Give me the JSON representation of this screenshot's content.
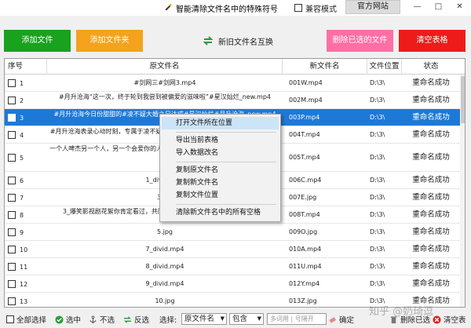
{
  "titlebar": {
    "title": "智能清除文件名中的特殊符号",
    "compat_label": "兼容模式",
    "website_label": "官方网站",
    "minimize": "—",
    "maximize": "□",
    "close": "✕"
  },
  "toolbar": {
    "add_file": "添加文件",
    "add_folder": "添加文件夹",
    "swap_names": "新旧文件名互换",
    "delete_selected": "删除已选的文件",
    "clear_table": "清空表格",
    "colors": {
      "add_file": "#18a21d",
      "add_folder": "#f5a21d",
      "delete_selected": "#ff6fa5",
      "clear_table": "#ee1b1b"
    }
  },
  "table": {
    "headers": {
      "num": "序号",
      "original": "原文件名",
      "new": "新文件名",
      "location": "文件位置",
      "status": "状态"
    },
    "rows": [
      {
        "num": "1",
        "original": "#剑网三#剑网3.mp4",
        "new": "001W.mp4",
        "location": "D:\\3\\",
        "status": "重命名成功"
      },
      {
        "num": "2",
        "original": "#月升沧海“这一次，终于轮到我尝到被偏爱的滋味啦”#星汉灿烂_new.mp4",
        "new": "002M.mp4",
        "location": "D:\\3\\",
        "status": "重命名成功"
      },
      {
        "num": "3",
        "original": "#月升沧海今日份甜甜的#凌不疑大婚之日达成#星汉灿烂#月升沧海_new.mp4",
        "new": "003P.mp4",
        "location": "D:\\3\\",
        "status": "重命名成功"
      },
      {
        "num": "4",
        "original": "#月升沧海表录心动时刻，专属于凌不疑的程少商#星汉灿烂#心动七夕_new.mp4",
        "new": "004T.mp4",
        "location": "D:\\3\\",
        "status": "重命名成功"
      },
      {
        "num": "5",
        "original": "一个人啤杰另一个人，另一个会爱你的人#治愈系音乐下手了#再见黄昏_new.mp4",
        "new": "005T.mp4",
        "location": "D:\\3\\",
        "status": "重命名成功"
      },
      {
        "num": "6",
        "original": "1_divid.mp4",
        "new": "006C.mp4",
        "location": "D:\\3\\",
        "status": "重命名成功"
      },
      {
        "num": "7",
        "original": "3.jpg",
        "new": "007E.jpg",
        "location": "D:\\3\\",
        "status": "重命名成功"
      },
      {
        "num": "8",
        "original": "3_爆笑影视剧花絮你肯定看过，共同见证明星的成长#我在抖音看看.mp4",
        "new": "008T.mp4",
        "location": "D:\\3\\",
        "status": "重命名成功"
      },
      {
        "num": "9",
        "original": "5.jpg",
        "new": "009O.jpg",
        "location": "D:\\3\\",
        "status": "重命名成功"
      },
      {
        "num": "10",
        "original": "7_divid.mp4",
        "new": "010A.mp4",
        "location": "D:\\3\\",
        "status": "重命名成功"
      },
      {
        "num": "11",
        "original": "8_divid.mp4",
        "new": "011U.mp4",
        "location": "D:\\3\\",
        "status": "重命名成功"
      },
      {
        "num": "12",
        "original": "9_divid.mp4",
        "new": "012Y.mp4",
        "location": "D:\\3\\",
        "status": "重命名成功"
      },
      {
        "num": "13",
        "original": "10.jpg",
        "new": "013Z.jpg",
        "location": "D:\\3\\",
        "status": "重命名成功"
      }
    ]
  },
  "context_menu": {
    "items": [
      "打开文件所在位置",
      "导出当前表格",
      "导入数据改名",
      "复制原文件名",
      "复制新文件名",
      "复制文件位置",
      "清除新文件名中的所有空格"
    ]
  },
  "bottom": {
    "select_all": "全部选择",
    "select": "选中",
    "deselect": "不选",
    "invert": "反选",
    "select_label": "选择:",
    "field_value": "原文件名",
    "match_value": "包含",
    "keyword_placeholder": "多词用 | 号隔开",
    "confirm": "确定",
    "delete_selected": "删除已选",
    "clear_table": "清空表"
  },
  "watermark": "知乎 @奶琦逗"
}
